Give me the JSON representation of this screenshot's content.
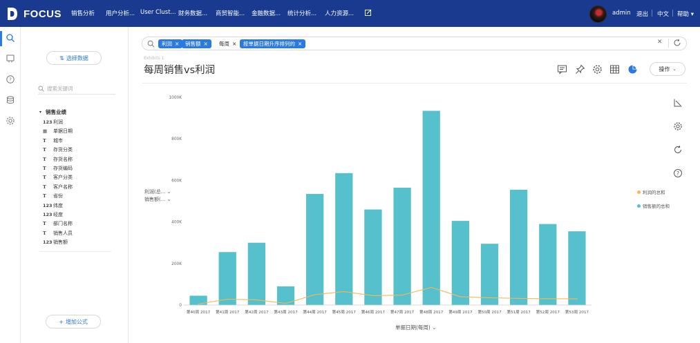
{
  "app": {
    "brand": "FOCUS",
    "nav": [
      "销售分析",
      "用户分析...",
      "User Clust...",
      "财务数据...",
      "商贸智能...",
      "金融数据...",
      "统计分析...",
      "人力资源..."
    ],
    "user": "admin",
    "logout": "退出",
    "language": "中文",
    "help": "帮助"
  },
  "panel": {
    "select_data": "选择数据",
    "search_placeholder": "搜索关键词",
    "tree_root": "销售业绩",
    "fields": [
      {
        "type": "123",
        "name": "利润"
      },
      {
        "type": "date",
        "name": "单据日期"
      },
      {
        "type": "T",
        "name": "城市"
      },
      {
        "type": "T",
        "name": "存货分类"
      },
      {
        "type": "T",
        "name": "存货名称"
      },
      {
        "type": "T",
        "name": "存货编码"
      },
      {
        "type": "T",
        "name": "客户分类"
      },
      {
        "type": "T",
        "name": "客户名称"
      },
      {
        "type": "T",
        "name": "省份"
      },
      {
        "type": "123",
        "name": "纬度"
      },
      {
        "type": "123",
        "name": "经度"
      },
      {
        "type": "T",
        "name": "部门名称"
      },
      {
        "type": "T",
        "name": "销售人员"
      },
      {
        "type": "123",
        "name": "销售额"
      }
    ],
    "add_formula": "增加公式"
  },
  "search": {
    "tokens": [
      {
        "label": "利润",
        "style": "blue"
      },
      {
        "label": "销售额",
        "style": "blue"
      },
      {
        "label": "每周",
        "style": "plain"
      },
      {
        "label": "按单据日期升序排列的",
        "style": "blue"
      }
    ]
  },
  "header": {
    "subtle_label": "Exhibits 1",
    "title": "每周销售vs利润",
    "operate": "操作"
  },
  "axis_pickers": [
    "利润(总...",
    "销售额(..."
  ],
  "x_title": "单据日期(每周)",
  "colors": {
    "bar": "#56c1cc",
    "line": "#f0b95a",
    "brand": "#1a3a8f",
    "accent": "#2b7ade"
  },
  "chart_data": {
    "type": "bar",
    "categories": [
      "第40周 2017",
      "第41周 2017",
      "第42周 2017",
      "第43周 2017",
      "第44周 2017",
      "第45周 2017",
      "第46周 2017",
      "第47周 2017",
      "第48周 2017",
      "第49周 2017",
      "第50周 2017",
      "第51周 2017",
      "第52周 2017",
      "第53周 2017"
    ],
    "series": [
      {
        "name": "销售额的总和",
        "kind": "bar",
        "values": [
          45000,
          255000,
          300000,
          90000,
          535000,
          635000,
          460000,
          565000,
          935000,
          405000,
          295000,
          555000,
          390000,
          355000
        ]
      },
      {
        "name": "利润的总和",
        "kind": "line",
        "values": [
          5000,
          28000,
          25000,
          8000,
          50000,
          65000,
          45000,
          48000,
          85000,
          40000,
          35000,
          32000,
          30000,
          30000
        ]
      }
    ],
    "y_ticks": [
      "0",
      "200K",
      "400K",
      "600K",
      "800K",
      "1000K"
    ],
    "ylim": [
      0,
      1000000
    ],
    "legend_position": "right"
  }
}
